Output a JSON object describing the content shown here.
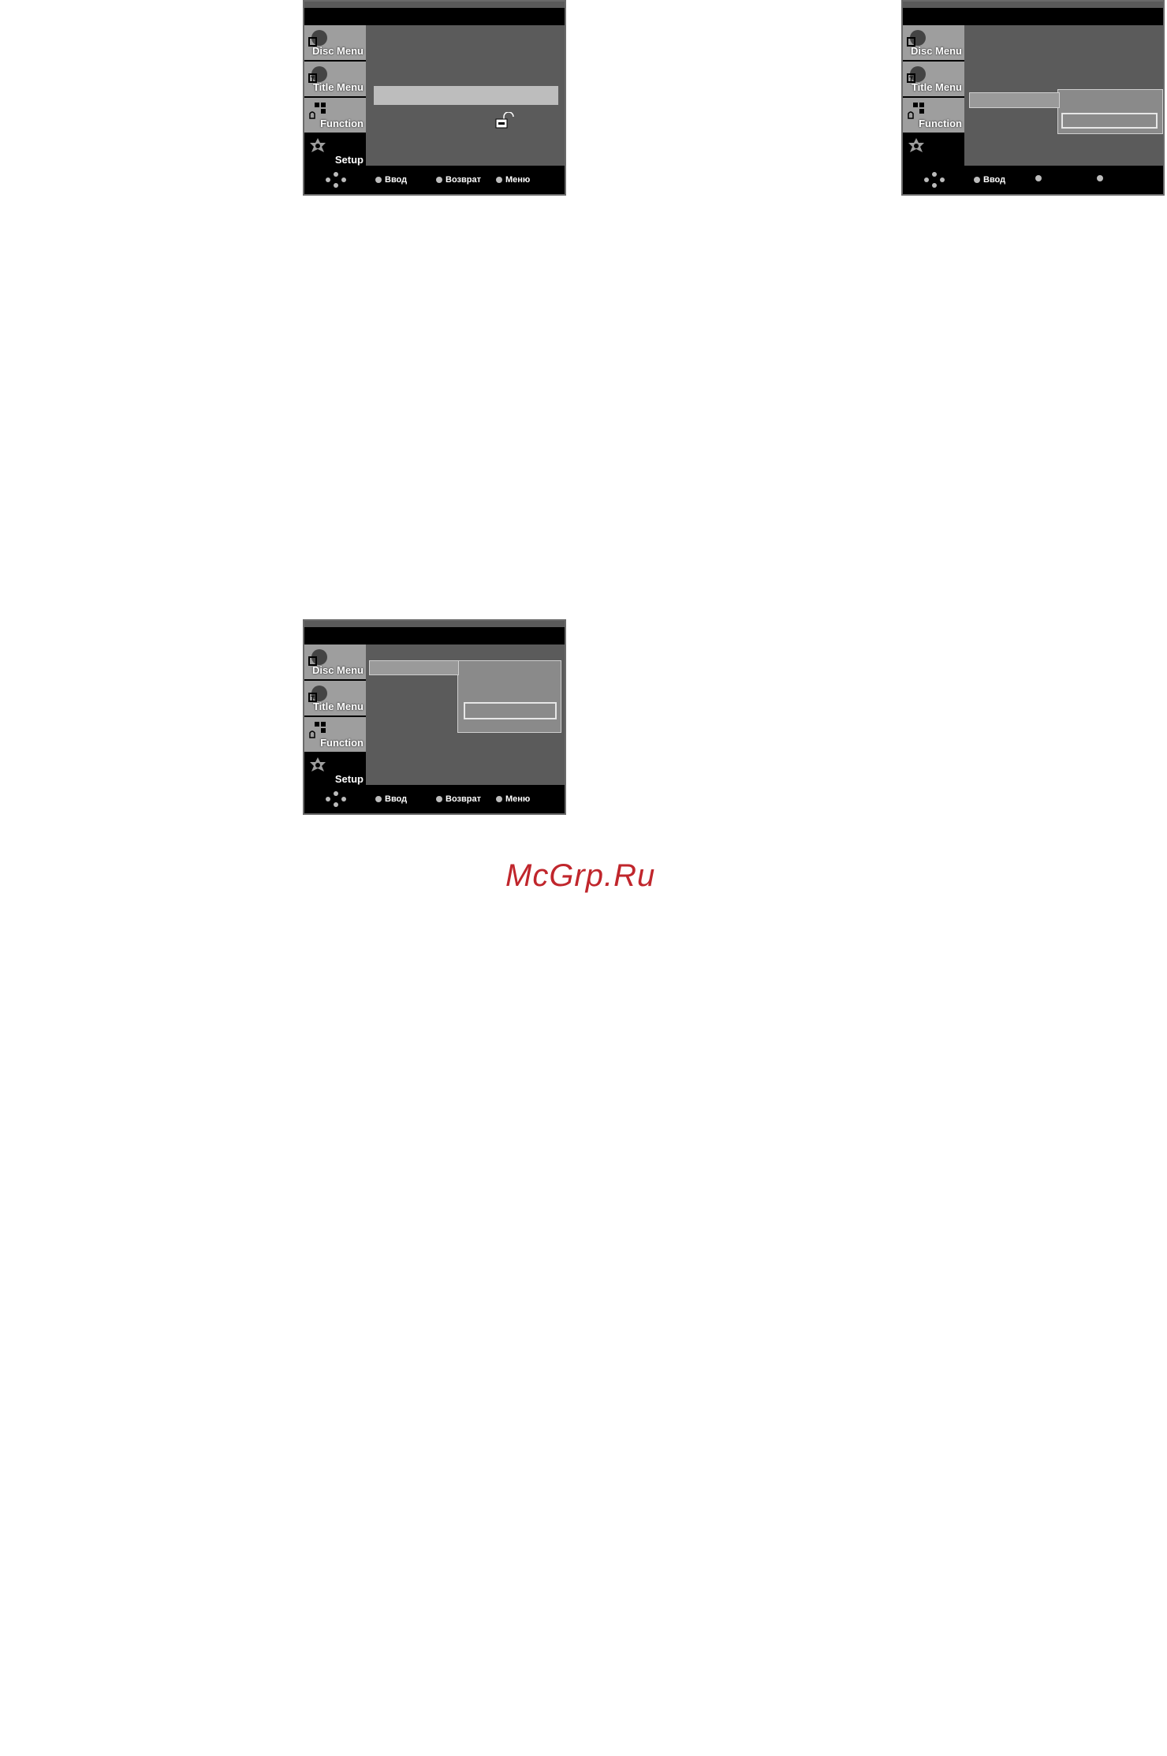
{
  "screens": [
    {
      "id": "a",
      "sidebar": [
        {
          "label": "Disc Menu",
          "icon": "disc-icon"
        },
        {
          "label": "Title Menu",
          "icon": "title-icon"
        },
        {
          "label": "Function",
          "icon": "function-icon"
        },
        {
          "label": "Setup",
          "icon": "gear-icon"
        }
      ],
      "footer": {
        "enter": "Ввод",
        "return": "Возврат",
        "menu": "Меню"
      }
    },
    {
      "id": "b",
      "sidebar": [
        {
          "label": "Disc Menu",
          "icon": "disc-icon"
        },
        {
          "label": "Title Menu",
          "icon": "title-icon"
        },
        {
          "label": "Function",
          "icon": "function-icon"
        },
        {
          "label": "",
          "icon": "gear-icon"
        }
      ],
      "footer": {
        "enter": "Ввод",
        "return": "",
        "menu": ""
      }
    },
    {
      "id": "c",
      "sidebar": [
        {
          "label": "Disc Menu",
          "icon": "disc-icon"
        },
        {
          "label": "Title Menu",
          "icon": "title-icon"
        },
        {
          "label": "Function",
          "icon": "function-icon"
        },
        {
          "label": "Setup",
          "icon": "gear-icon"
        }
      ],
      "footer": {
        "enter": "Ввод",
        "return": "Возврат",
        "menu": "Меню"
      }
    }
  ],
  "watermark": "McGrp.Ru",
  "colors": {
    "osd_background": "#5b5b5b",
    "sidebar_item": "#9e9e9e",
    "active_item": "#000000",
    "watermark": "#c0262c"
  }
}
